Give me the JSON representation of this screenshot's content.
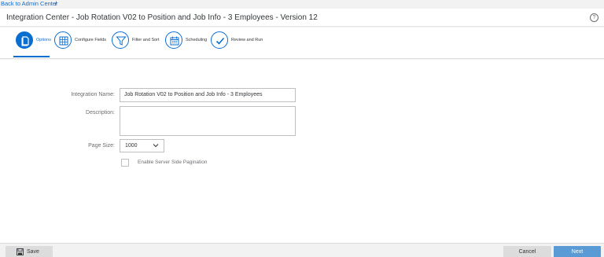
{
  "breadcrumb": {
    "link": "Back to Admin Center",
    "separator": "/"
  },
  "header": {
    "title": "Integration Center - Job Rotation V02 to Position and Job Info - 3 Employees - Version 12",
    "help_icon": "?"
  },
  "steps": [
    {
      "label": "Options",
      "icon": "document-icon",
      "active": true
    },
    {
      "label": "Configure Fields",
      "icon": "grid-icon",
      "active": false
    },
    {
      "label": "Filter and Sort",
      "icon": "filter-icon",
      "active": false
    },
    {
      "label": "Scheduling",
      "icon": "calendar-icon",
      "active": false
    },
    {
      "label": "Review and Run",
      "icon": "checkmark-icon",
      "active": false
    }
  ],
  "form": {
    "integration_name_label": "Integration Name:",
    "integration_name_value": "Job Rotation V02 to Position and Job Info - 3 Employees",
    "description_label": "Description:",
    "description_value": "",
    "page_size_label": "Page Size:",
    "page_size_value": "1000",
    "pagination_label": "Enable Server Side Pagination",
    "pagination_checked": false
  },
  "footer": {
    "save_label": "Save",
    "cancel_label": "Cancel",
    "next_label": "Next"
  },
  "colors": {
    "accent": "#0a6ed1",
    "next_button": "#5b9bd5"
  }
}
